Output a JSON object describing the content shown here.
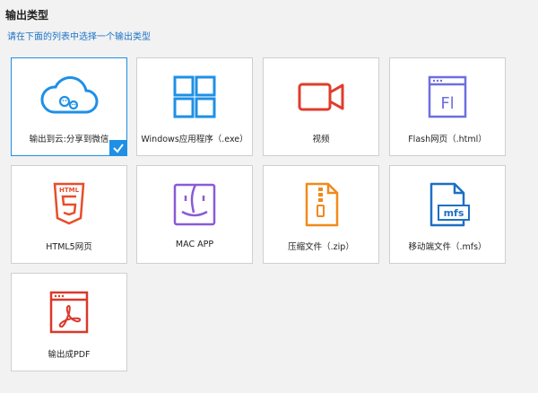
{
  "header": {
    "title": "输出类型",
    "subtitle": "请在下面的列表中选择一个输出类型"
  },
  "options": [
    {
      "label": "输出到云:分享到微信",
      "icon": "cloud-share-icon",
      "selected": true
    },
    {
      "label": "Windows应用程序（.exe）",
      "icon": "windows-icon",
      "selected": false
    },
    {
      "label": "视频",
      "icon": "video-camera-icon",
      "selected": false
    },
    {
      "label": "Flash网页（.html）",
      "icon": "flash-page-icon",
      "selected": false
    },
    {
      "label": "HTML5网页",
      "icon": "html5-icon",
      "selected": false
    },
    {
      "label": "MAC APP",
      "icon": "mac-finder-icon",
      "selected": false
    },
    {
      "label": "压缩文件（.zip）",
      "icon": "zip-file-icon",
      "selected": false
    },
    {
      "label": "移动端文件（.mfs）",
      "icon": "mfs-file-icon",
      "selected": false
    },
    {
      "label": "输出成PDF",
      "icon": "pdf-icon",
      "selected": false
    }
  ],
  "icon_text": {
    "flash": "Fl",
    "html5": "HTML",
    "mfs": "mfs"
  },
  "colors": {
    "accent": "#1e90e6",
    "cloud": "#1e90e6",
    "windows": "#1e90e6",
    "video": "#e03c2c",
    "flash": "#6d6ee0",
    "html5": "#e84d2b",
    "mac": "#8b5ad6",
    "zip": "#f08a1c",
    "mfs": "#1e6fc4",
    "pdf": "#d9392b"
  }
}
